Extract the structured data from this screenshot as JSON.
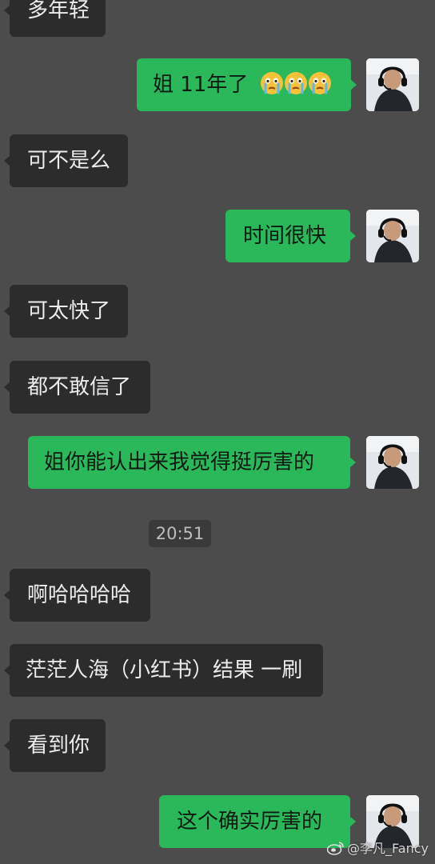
{
  "chat": {
    "messages": [
      {
        "side": "in",
        "text": "多年轻"
      },
      {
        "side": "out",
        "text": "姐 11年了",
        "emoji": [
          "crying-face",
          "crying-face",
          "crying-face"
        ]
      },
      {
        "side": "in",
        "text": "可不是么"
      },
      {
        "side": "out",
        "text": "时间很快"
      },
      {
        "side": "in",
        "text": "可太快了"
      },
      {
        "side": "in",
        "text": "都不敢信了"
      },
      {
        "side": "out",
        "text": "姐你能认出来我觉得挺厉害的"
      },
      {
        "side": "in",
        "text": "啊哈哈哈哈"
      },
      {
        "side": "in",
        "text": "茫茫人海（小红书）结果 一刷"
      },
      {
        "side": "in",
        "text": "看到你"
      },
      {
        "side": "out",
        "text": "这个确实厉害的"
      }
    ],
    "timestamp": "20:51"
  },
  "watermark": {
    "text": "@李凡_Fancy",
    "icon": "weibo-icon"
  },
  "colors": {
    "background": "#4c4c4c",
    "incoming_bubble": "#2c2c2c",
    "outgoing_bubble": "#2bb85b",
    "incoming_text": "#ececec",
    "outgoing_text": "#0c1a10"
  }
}
